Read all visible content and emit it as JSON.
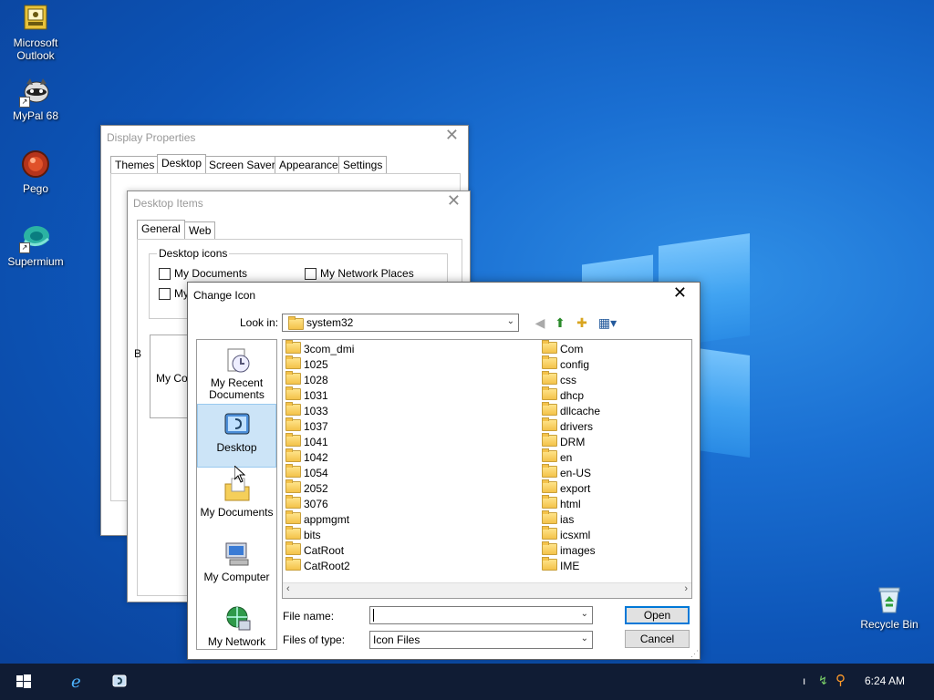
{
  "desktop": {
    "icons": [
      {
        "label": "Microsoft\nOutlook",
        "icon": "outlook-icon"
      },
      {
        "label": "MyPal 68",
        "icon": "mypal-icon"
      },
      {
        "label": "Pego",
        "icon": "pego-icon"
      },
      {
        "label": "Supermium",
        "icon": "supermium-icon"
      },
      {
        "label": "Recycle Bin",
        "icon": "recycle-bin-icon"
      }
    ]
  },
  "display_properties": {
    "title": "Display Properties",
    "tabs": [
      "Themes",
      "Desktop",
      "Screen Saver",
      "Appearance",
      "Settings"
    ],
    "selected_tab": "Desktop"
  },
  "desktop_items": {
    "title": "Desktop Items",
    "tabs": [
      "General",
      "Web"
    ],
    "selected_tab": "General",
    "group_label": "Desktop icons",
    "checkboxes": [
      "My Documents",
      "My Network Places",
      "My"
    ],
    "partial_labels": [
      "My Co",
      "B"
    ]
  },
  "change_icon": {
    "title": "Change Icon",
    "look_in_label": "Look in:",
    "look_in_value": "system32",
    "places": [
      {
        "label": "My Recent\nDocuments",
        "icon": "recent-documents-icon"
      },
      {
        "label": "Desktop",
        "icon": "desktop-icon"
      },
      {
        "label": "My Documents",
        "icon": "my-documents-icon"
      },
      {
        "label": "My Computer",
        "icon": "my-computer-icon"
      },
      {
        "label": "My Network",
        "icon": "my-network-icon"
      }
    ],
    "selected_place": "Desktop",
    "folders_left": [
      "3com_dmi",
      "1025",
      "1028",
      "1031",
      "1033",
      "1037",
      "1041",
      "1042",
      "1054",
      "2052",
      "3076",
      "appmgmt",
      "bits",
      "CatRoot",
      "CatRoot2"
    ],
    "folders_right": [
      "Com",
      "config",
      "css",
      "dhcp",
      "dllcache",
      "drivers",
      "DRM",
      "en",
      "en-US",
      "export",
      "html",
      "ias",
      "icsxml",
      "images",
      "IME"
    ],
    "file_name_label": "File name:",
    "file_name_value": "",
    "files_of_type_label": "Files of type:",
    "files_of_type_value": "Icon Files",
    "open_label": "Open",
    "cancel_label": "Cancel"
  },
  "taskbar": {
    "clock": "6:24 AM",
    "tray_char": "ı"
  }
}
